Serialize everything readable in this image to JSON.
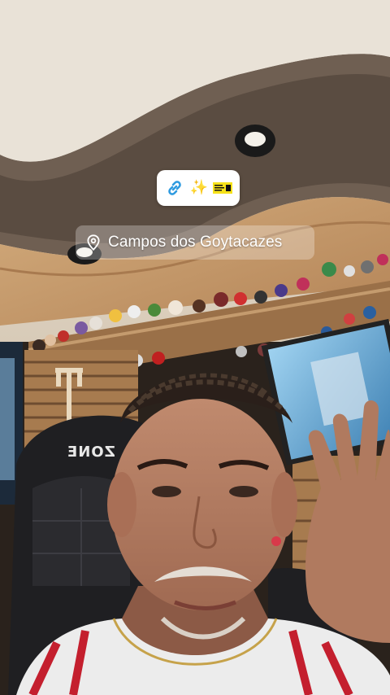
{
  "story": {
    "link_sticker": {
      "icons": [
        "link-icon",
        "sparkles-icon",
        "brand-logo-icon"
      ],
      "sparkle_glyph": "✨",
      "brand_text": "",
      "accent": "#2f9be0"
    },
    "location_sticker": {
      "icon": "location-pin-icon",
      "label": "Campos dos Goytacazes"
    },
    "background": {
      "description_free": true,
      "chair_text": "ZONE"
    }
  }
}
